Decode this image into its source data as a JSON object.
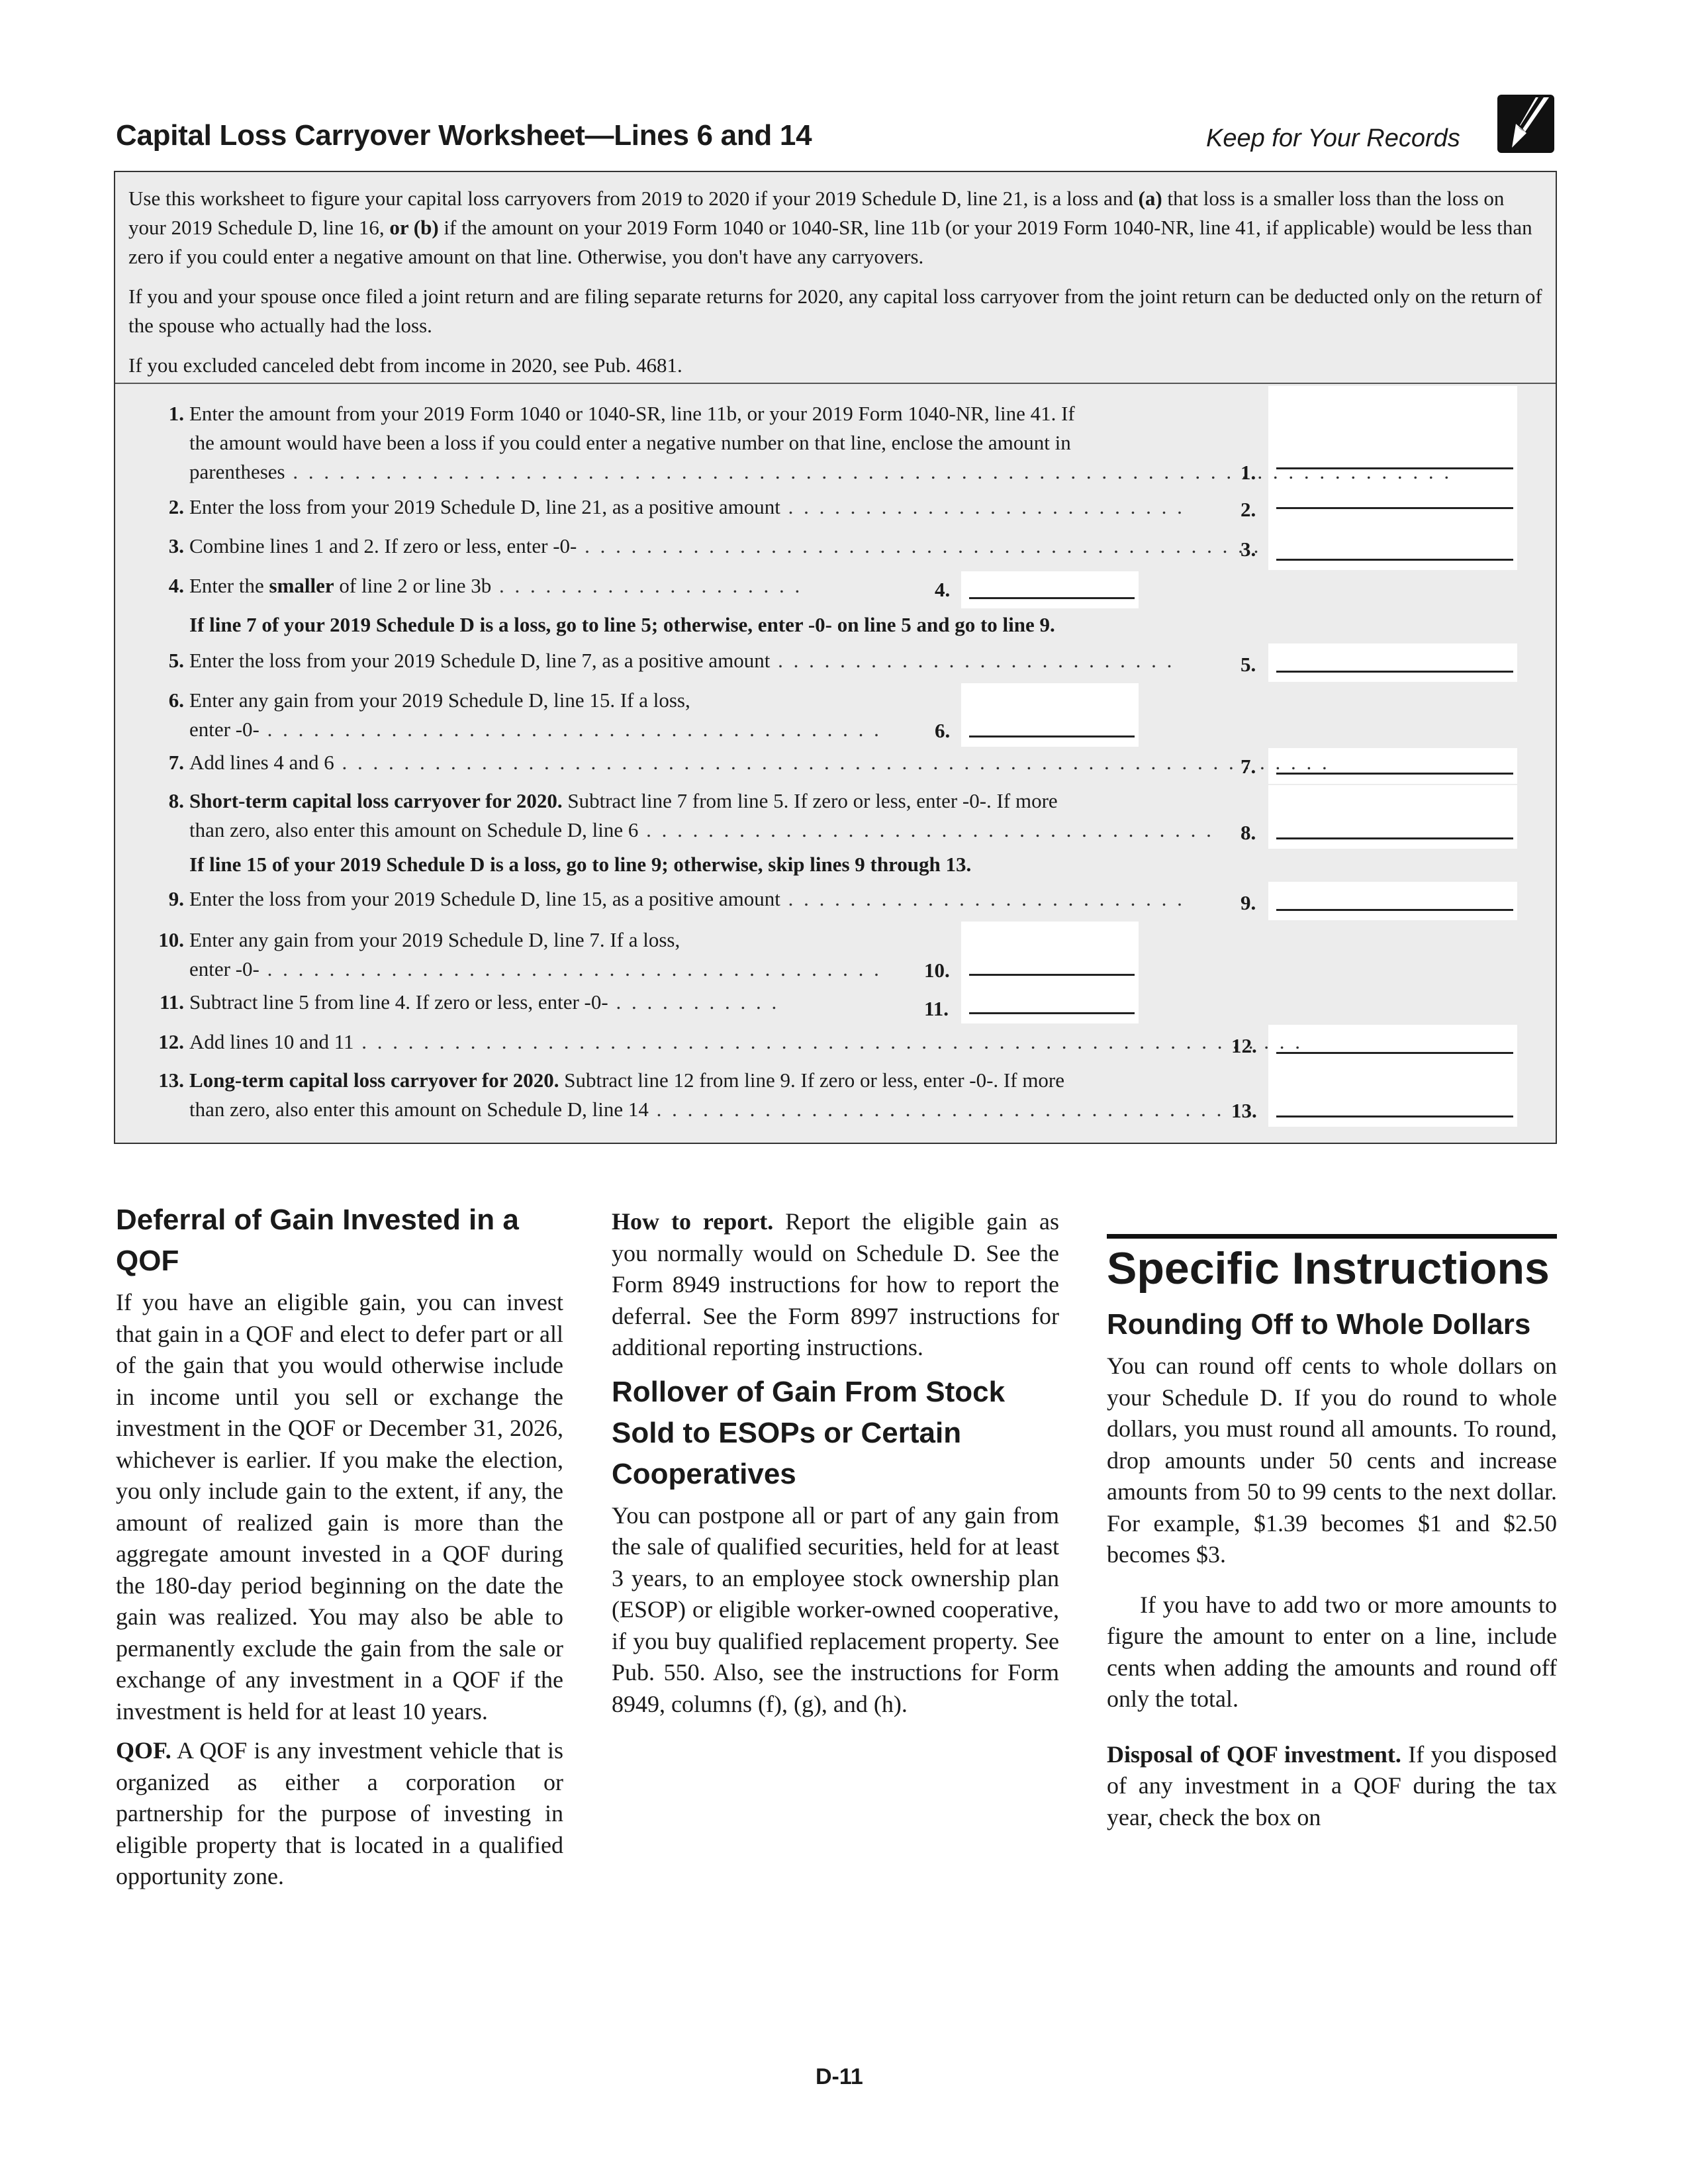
{
  "header": {
    "title": "Capital Loss Carryover Worksheet—Lines 6 and 14",
    "keep_label": "Keep for Your Records",
    "icon": "pencil-icon"
  },
  "worksheet": {
    "intro": [
      {
        "pre": "Use this worksheet to figure your capital loss carryovers from 2019 to 2020 if your 2019 Schedule D, line 21, is a loss and ",
        "b1": "(a)",
        "mid": " that loss is a smaller loss than the loss on your 2019 Schedule D, line 16, ",
        "b2": "or (b)",
        "post": " if the amount on your 2019 Form 1040 or 1040-SR, line 11b (or your 2019 Form 1040-NR, line 41, if applicable) would be less than zero if you could enter a negative amount on that line. Otherwise, you don't have any carryovers."
      },
      {
        "text": "If you and your spouse once filed a joint return and are filing separate returns for 2020, any capital loss carryover from the joint return can be deducted only on the return of the spouse who actually had the loss."
      },
      {
        "text": "If you excluded canceled debt from income in 2020, see Pub. 4681."
      }
    ],
    "lines": [
      {
        "num": "1.",
        "text1": "Enter the amount from your 2019 Form 1040 or 1040-SR, line 11b, or your 2019 Form 1040-NR, line 41. If",
        "text2": "the amount would have been a loss if you could enter a negative number on that line, enclose the amount in",
        "text3": "parentheses",
        "ref": "1.",
        "value": ""
      },
      {
        "num": "2.",
        "text": "Enter the loss from your 2019 Schedule D, line 21, as a positive amount",
        "ref": "2.",
        "value": ""
      },
      {
        "num": "3.",
        "text": "Combine lines 1 and 2. If zero or less, enter -0-",
        "ref": "3.",
        "value": ""
      },
      {
        "num": "4.",
        "pre": "Enter the ",
        "bold": "smaller",
        "post": " of line 2 or line 3b",
        "ref": "4.",
        "value": ""
      },
      {
        "num": "5.",
        "text": "Enter the loss from your 2019 Schedule D, line 7, as a positive amount",
        "ref": "5.",
        "value": ""
      },
      {
        "num": "6.",
        "text1": "Enter any gain from your 2019 Schedule D, line 15. If a loss,",
        "text2": "enter -0-",
        "ref": "6.",
        "value": ""
      },
      {
        "num": "7.",
        "text": "Add lines 4 and 6",
        "ref": "7.",
        "value": ""
      },
      {
        "num": "8.",
        "bold": "Short-term capital loss carryover for 2020.",
        "post": " Subtract line 7 from line 5. If zero or less, enter -0-. If more",
        "text2": "than zero, also enter this amount on Schedule D, line 6",
        "ref": "8.",
        "value": ""
      },
      {
        "num": "9.",
        "text": "Enter the loss from your 2019 Schedule D, line 15, as a positive amount",
        "ref": "9.",
        "value": ""
      },
      {
        "num": "10.",
        "text1": "Enter any gain from your 2019 Schedule D, line 7. If a loss,",
        "text2": "enter -0-",
        "ref": "10.",
        "value": ""
      },
      {
        "num": "11.",
        "text": "Subtract line 5 from line 4. If zero or less, enter -0-",
        "ref": "11.",
        "value": ""
      },
      {
        "num": "12.",
        "text": "Add lines 10 and 11",
        "ref": "12.",
        "value": ""
      },
      {
        "num": "13.",
        "bold": "Long-term capital loss carryover for 2020.",
        "post": " Subtract line 12 from line 9. If zero or less, enter -0-. If more",
        "text2": "than zero, also enter this amount on Schedule D, line 14",
        "ref": "13.",
        "value": ""
      }
    ],
    "cond_a": "If line 7 of your 2019 Schedule D is a loss, go to line 5; otherwise, enter -0- on line 5 and go to line 9.",
    "cond_b": "If line 15 of your 2019 Schedule D is a loss, go to line 9; otherwise, skip lines 9 through 13."
  },
  "col1": {
    "heading": "Deferral of Gain Invested in a QOF",
    "p1": "If you have an eligible gain, you can invest that gain in a QOF and elect to defer part or all of the gain that you would otherwise include in income until you sell or exchange the investment in the QOF or December 31, 2026, whichever is earlier. If you make the election, you only include gain to the extent, if any, the amount of realized gain is more than the aggregate amount invested in a QOF during the 180-day period beginning on the date the gain was realized. You may also be able to permanently exclude the gain from the sale or exchange of any investment in a QOF if the investment is held for at least 10 years.",
    "p2_bold": "QOF.",
    "p2": " A QOF is any investment vehicle that is organized as either a corporation or partnership for the purpose of investing in eligible property that is located in a qualified opportunity zone."
  },
  "col2": {
    "p1_bold": "How to report.",
    "p1": " Report the eligible gain as you normally would on Schedule D. See the Form 8949 instructions for how to report the deferral. See the Form 8997 instructions for additional reporting instructions.",
    "heading": "Rollover of Gain From Stock Sold to ESOPs or Certain Cooperatives",
    "p2": "You can postpone all or part of any gain from the sale of qualified securities, held for at least 3 years, to an employee stock ownership plan (ESOP) or eligible worker-owned cooperative, if you buy qualified replacement property. See Pub. 550. Also, see the instructions for Form 8949, columns (f), (g), and (h)."
  },
  "col3": {
    "section": "Specific Instructions",
    "heading": "Rounding Off to Whole Dollars",
    "p1": "You can round off cents to whole dollars on your Schedule D. If you do round to whole dollars, you must round all amounts. To round, drop amounts under 50 cents and increase amounts from 50 to 99 cents to the next dollar. For example, $1.39 becomes $1 and $2.50 becomes $3.",
    "p2": "If you have to add two or more amounts to figure the amount to enter on a line, include cents when adding the amounts and round off only the total.",
    "p3_bold": "Disposal of QOF investment.",
    "p3": " If you disposed of any investment in a QOF during the tax year, check the box on"
  },
  "footer": {
    "page": "D-11"
  }
}
